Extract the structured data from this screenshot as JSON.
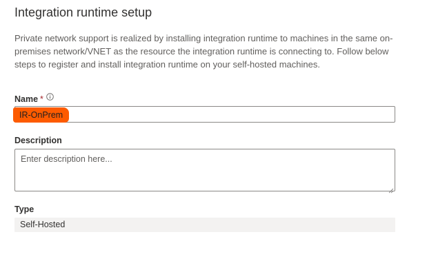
{
  "header": {
    "title": "Integration runtime setup"
  },
  "intro": {
    "text": "Private network support is realized by installing integration runtime to machines in the same on-premises network/VNET as the resource the integration runtime is connecting to. Follow below steps to register and install integration runtime on your self-hosted machines."
  },
  "name_field": {
    "label": "Name",
    "required_marker": "*",
    "info_icon": "info-icon",
    "value": "IR-OnPrem",
    "highlight_color": "#fd5b00"
  },
  "description_field": {
    "label": "Description",
    "value": "",
    "placeholder": "Enter description here..."
  },
  "type_field": {
    "label": "Type",
    "value": "Self-Hosted"
  }
}
